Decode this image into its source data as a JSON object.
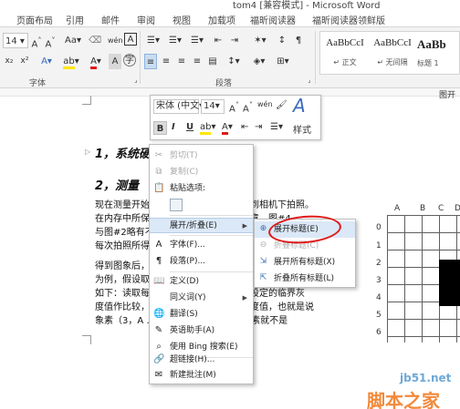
{
  "window": {
    "title": "tom4 [兼容模式] - Microsoft Word"
  },
  "tabs": [
    "页面布局",
    "引用",
    "邮件",
    "审阅",
    "视图",
    "加载项",
    "福昕阅读器",
    "福昕阅读器领鲜版"
  ],
  "ribbon": {
    "font_size": "14",
    "group_font": "字体",
    "group_paragraph": "段落",
    "styles": [
      {
        "preview": "AaBbCcI",
        "name": "↵ 正文"
      },
      {
        "preview": "AaBbCcI",
        "name": "↵ 无间隔"
      },
      {
        "preview": "AaBb",
        "name": "标题 1"
      }
    ]
  },
  "document": {
    "heading1": "1，系统硬件搭建",
    "heading2": "2，测量",
    "para1": [
      "现在测量开始，首先我们要将被测物放到相机下拍照。",
      "在内存中所保存的照片，并且请大家注意，图#4",
      "与图#2略有不同，",
      "每次拍照所得"
    ],
    "para2": [
      "得到图象后，第一步是把量测的：取第 3",
      "为例，假设取的：",
      "如下：读取每个象素的灰度值与刚才所设定的临界灰",
      "度值作比较，如果大于所设定的临界灰度值，也就是说",
      "象素（3，A ……如图#4，那么这个象素就不是"
    ],
    "fig_label": "图开",
    "grid_cols": [
      "A",
      "B",
      "C",
      "D"
    ],
    "grid_rows": [
      "0",
      "1",
      "2",
      "3",
      "4",
      "5",
      "6"
    ]
  },
  "mini_toolbar": {
    "font_name": "宋体 (中文",
    "font_size": "14",
    "bold": "B",
    "italic": "I",
    "underline": "U",
    "styles_label": "样式"
  },
  "context_menu": {
    "items": [
      {
        "label": "剪切(T)",
        "icon": "scissors-icon",
        "glyph": "✂",
        "disabled": true
      },
      {
        "label": "复制(C)",
        "icon": "copy-icon",
        "glyph": "⧉",
        "disabled": true
      },
      {
        "label": "粘贴选项:",
        "icon": "paste-icon",
        "glyph": "📋",
        "disabled": false
      },
      {
        "label": "展开/折叠(E)",
        "icon": "expand-collapse-icon",
        "glyph": "",
        "disabled": false,
        "highlight": true,
        "submenu": true
      },
      {
        "label": "字体(F)...",
        "icon": "font-icon",
        "glyph": "A",
        "disabled": false
      },
      {
        "label": "段落(P)...",
        "icon": "paragraph-icon",
        "glyph": "¶",
        "disabled": false
      },
      {
        "label": "定义(D)",
        "icon": "define-icon",
        "glyph": "📖",
        "disabled": false
      },
      {
        "label": "同义词(Y)",
        "icon": "synonyms-icon",
        "glyph": "",
        "disabled": false,
        "submenu": true
      },
      {
        "label": "翻译(S)",
        "icon": "translate-icon",
        "glyph": "🌐",
        "disabled": false
      },
      {
        "label": "英语助手(A)",
        "icon": "english-assistant-icon",
        "glyph": "✎",
        "disabled": false
      },
      {
        "label": "使用 Bing 搜索(E)",
        "icon": "bing-search-icon",
        "glyph": "⌕",
        "disabled": false
      },
      {
        "label": "超链接(H)...",
        "icon": "hyperlink-icon",
        "glyph": "🔗",
        "disabled": false
      },
      {
        "label": "新建批注(M)",
        "icon": "new-comment-icon",
        "glyph": "✉",
        "disabled": false
      }
    ]
  },
  "submenu": {
    "items": [
      {
        "label": "展开标题(E)",
        "highlight": true
      },
      {
        "label": "折叠标题(C)",
        "disabled": true
      },
      {
        "label": "展开所有标题(X)"
      },
      {
        "label": "折叠所有标题(L)"
      }
    ]
  },
  "watermark": {
    "line1": "jb51.net",
    "line2": "脚本之家"
  },
  "colors": {
    "highlight": "#dbe8f7",
    "annotation": "#e01818",
    "watermark_blue": "#6fa8d6",
    "watermark_orange": "#f28a3c"
  }
}
